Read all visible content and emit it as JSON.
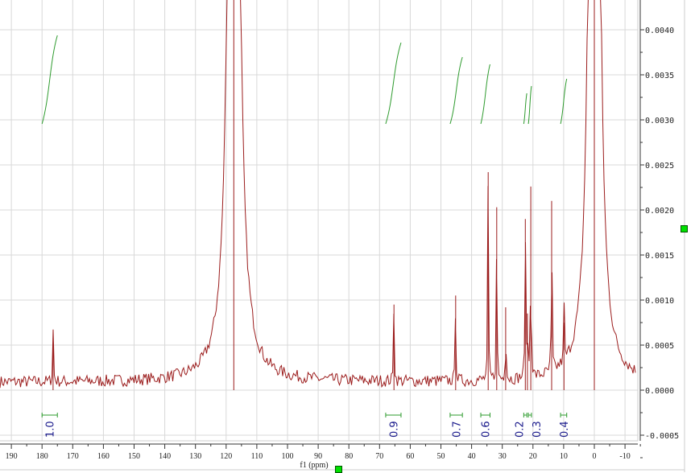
{
  "chart_data": {
    "type": "line",
    "title": "",
    "xlabel": "f1 (ppm)",
    "ylabel": "",
    "xlim": [
      193,
      -14
    ],
    "ylim": [
      -0.00065,
      0.0043
    ],
    "x_ticks": [
      190,
      180,
      170,
      160,
      150,
      140,
      130,
      120,
      110,
      100,
      90,
      80,
      70,
      60,
      50,
      40,
      30,
      20,
      10,
      0,
      -10
    ],
    "y_ticks": [
      "0.0040",
      "0.0035",
      "0.0030",
      "0.0025",
      "0.0020",
      "0.0015",
      "0.0010",
      "0.0005",
      "0.0000",
      "-0.0005"
    ],
    "y_tick_values": [
      0.004,
      0.0035,
      0.003,
      0.0025,
      0.002,
      0.0015,
      0.001,
      0.0005,
      0,
      -0.0005
    ],
    "grid": true,
    "baseline_noise": 0.00015,
    "series_color": "#9b1c1c",
    "peaks": [
      {
        "ppm": 176.4,
        "height": 0.00058,
        "width": 0.15
      },
      {
        "ppm": 117.5,
        "height": 0.02,
        "width": 1.2
      },
      {
        "ppm": 65.3,
        "height": 0.00095,
        "width": 0.12
      },
      {
        "ppm": 45.2,
        "height": 0.00105,
        "width": 0.12
      },
      {
        "ppm": 34.6,
        "height": 0.00242,
        "width": 0.12
      },
      {
        "ppm": 31.8,
        "height": 0.00203,
        "width": 0.12
      },
      {
        "ppm": 28.9,
        "height": 0.00092,
        "width": 0.12
      },
      {
        "ppm": 22.5,
        "height": 0.0019,
        "width": 0.12
      },
      {
        "ppm": 21.8,
        "height": 0.00085,
        "width": 0.12
      },
      {
        "ppm": 20.7,
        "height": 0.00226,
        "width": 0.12
      },
      {
        "ppm": 13.9,
        "height": 0.0021,
        "width": 0.12
      },
      {
        "ppm": 9.9,
        "height": 0.00075,
        "width": 0.12
      },
      {
        "ppm": 0.0,
        "height": 0.03,
        "width": 0.9
      }
    ],
    "integrals": [
      {
        "from": 180,
        "to": 175,
        "value": "1.0"
      },
      {
        "from": 68,
        "to": 63,
        "value": "0.9"
      },
      {
        "from": 47,
        "to": 43,
        "value": "0.7"
      },
      {
        "from": 37,
        "to": 34,
        "value": "0.6"
      },
      {
        "from": 23,
        "to": 22,
        "value": "0.2"
      },
      {
        "from": 21.5,
        "to": 20.5,
        "value": "0.3"
      },
      {
        "from": 11,
        "to": 9,
        "value": "0.4"
      }
    ],
    "integral_color": "#2e9b2e",
    "integral_label_color": "#1a1a8c"
  }
}
